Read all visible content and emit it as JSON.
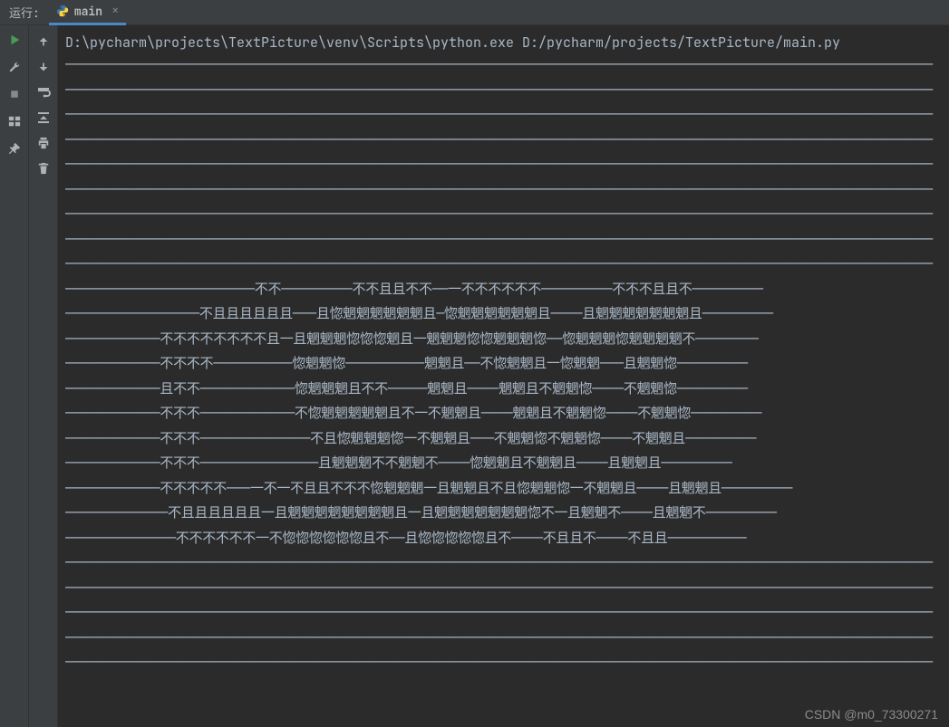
{
  "header": {
    "run_label": "运行:",
    "tab_name": "main",
    "close_label": "×"
  },
  "console": {
    "command": "D:\\pycharm\\projects\\TextPicture\\venv\\Scripts\\python.exe D:/pycharm/projects/TextPicture/main.py",
    "lines": [
      "——————————————————————————————————————————————————————————————————————————————————————————————————————————————",
      "——————————————————————————————————————————————————————————————————————————————————————————————————————————————",
      "——————————————————————————————————————————————————————————————————————————————————————————————————————————————",
      "——————————————————————————————————————————————————————————————————————————————————————————————————————————————",
      "——————————————————————————————————————————————————————————————————————————————————————————————————————————————",
      "——————————————————————————————————————————————————————————————————————————————————————————————————————————————",
      "——————————————————————————————————————————————————————————————————————————————————————————————————————————————",
      "——————————————————————————————————————————————————————————————————————————————————————————————————————————————",
      "——————————————————————————————————————————————————————————————————————————————————————————————————————————————",
      "————————————————————————不不—————————不不且且不不——一不不不不不不—————————不不不且且不—————————",
      "—————————————————不且且且且且且———且惚魍魍魍魍魍魍且—惚魍魍魍魍魍魍且————且魍魍魍魍魍魍魍且—————————",
      "————————————不不不不不不不不且一且魍魍魍惚惚惚魍且一魍魍魍惚惚魍魍魍惚——惚魍魍魍惚魍魍魍魍不————————",
      "————————————不不不不——————————惚魍魍惚——————————魍魍且——不惚魍魍且一惚魍魍———且魍魍惚—————————",
      "————————————且不不————————————惚魍魍魍且不不—————魍魍且————魍魍且不魍魍惚————不魍魍惚—————————",
      "————————————不不不————————————不惚魍魍魍魍魍且不一不魍魍且————魍魍且不魍魍惚————不魍魍惚—————————",
      "————————————不不不——————————————不且惚魍魍魍惚一不魍魍且———不魍魍惚不魍魍惚————不魍魍且—————————",
      "————————————不不不———————————————且魍魍魍不不魍魍不————惚魍魍且不魍魍且————且魍魍且—————————",
      "————————————不不不不不———一不一不且且不不不惚魍魍魍一且魍魍且不且惚魍魍惚一不魍魍且————且魍魍且—————————",
      "—————————————不且且且且且且一且魍魍魍魍魍魍魍魍且一且魍魍魍魍魍魍魍惚不一且魍魍不————且魍魍不—————————",
      "——————————————不不不不不不一不惚惚惚惚惚惚且不——且惚惚惚惚惚且不————不且且不————不且且——————————",
      "——————————————————————————————————————————————————————————————————————————————————————————————————————————————",
      "——————————————————————————————————————————————————————————————————————————————————————————————————————————————",
      "——————————————————————————————————————————————————————————————————————————————————————————————————————————————",
      "——————————————————————————————————————————————————————————————————————————————————————————————————————————————",
      "——————————————————————————————————————————————————————————————————————————————————————————————————————————————"
    ]
  },
  "watermark": "CSDN @m0_73300271"
}
